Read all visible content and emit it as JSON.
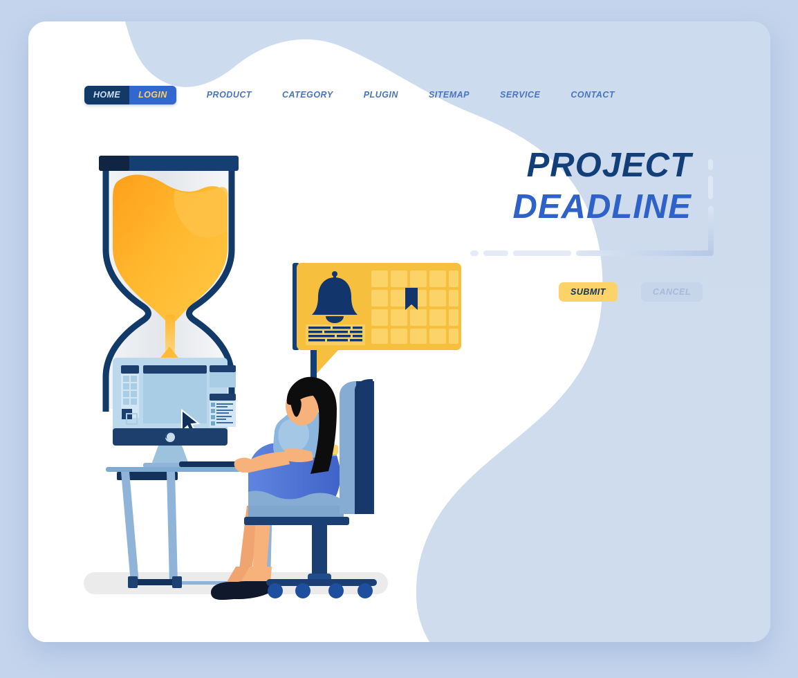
{
  "page": {
    "background_color": "#c3d4ec",
    "card_color": "#cfdcee",
    "card_blob_color": "#ffffff"
  },
  "nav": {
    "pill": {
      "home_label": "HOME",
      "login_label": "LOGIN",
      "home_bg": "#123a69",
      "login_bg": "#3267cf",
      "home_text_color": "#cfe0f5",
      "login_text_color": "#ffd166"
    },
    "links": [
      {
        "label": "PRODUCT"
      },
      {
        "label": "CATEGORY"
      },
      {
        "label": "PLUGIN"
      },
      {
        "label": "SITEMAP"
      },
      {
        "label": "SERVICE"
      },
      {
        "label": "CONTACT"
      }
    ],
    "link_color": "#4a74bb"
  },
  "hero": {
    "line1": "PROJECT",
    "line2": "DEADLINE",
    "line1_color": "#133f79",
    "line2_color": "#2f62c8"
  },
  "actions": {
    "submit_label": "SUBMIT",
    "cancel_label": "CANCEL",
    "submit_bg": "#fcd368",
    "submit_text_color": "#13305e",
    "cancel_bg": "#c6d5ea",
    "cancel_text_color": "#a7bbd8"
  },
  "illustration": {
    "name": "woman-at-desk-with-hourglass-and-notification",
    "elements": [
      {
        "name": "hourglass",
        "sand_color": "#ffb72b",
        "frame_color": "#123a69"
      },
      {
        "name": "desktop-monitor",
        "screen_color": "#bcd8ec",
        "bezel_color": "#1c3f6e"
      },
      {
        "name": "desk",
        "top_color": "#7fabd3",
        "leg_color": "#8fb4d8"
      },
      {
        "name": "notification-bubble",
        "bg_color": "#f7bf3e",
        "accent_color": "#12356b"
      },
      {
        "name": "bell-icon",
        "color": "#12356b"
      },
      {
        "name": "calendar-grid",
        "cell_color": "#fcd368"
      },
      {
        "name": "bookmark-icon",
        "color": "#12356b"
      },
      {
        "name": "woman-seated",
        "skin_color": "#f3aa73",
        "hair_color": "#0d0d0d",
        "shirt_color": "#7fb0dc",
        "skirt_color": "#4a6fd2"
      },
      {
        "name": "office-chair",
        "back_color": "#1b3f73",
        "cushion_color": "#86acd3"
      },
      {
        "name": "floor-shadow",
        "color": "#ebebeb"
      }
    ]
  }
}
